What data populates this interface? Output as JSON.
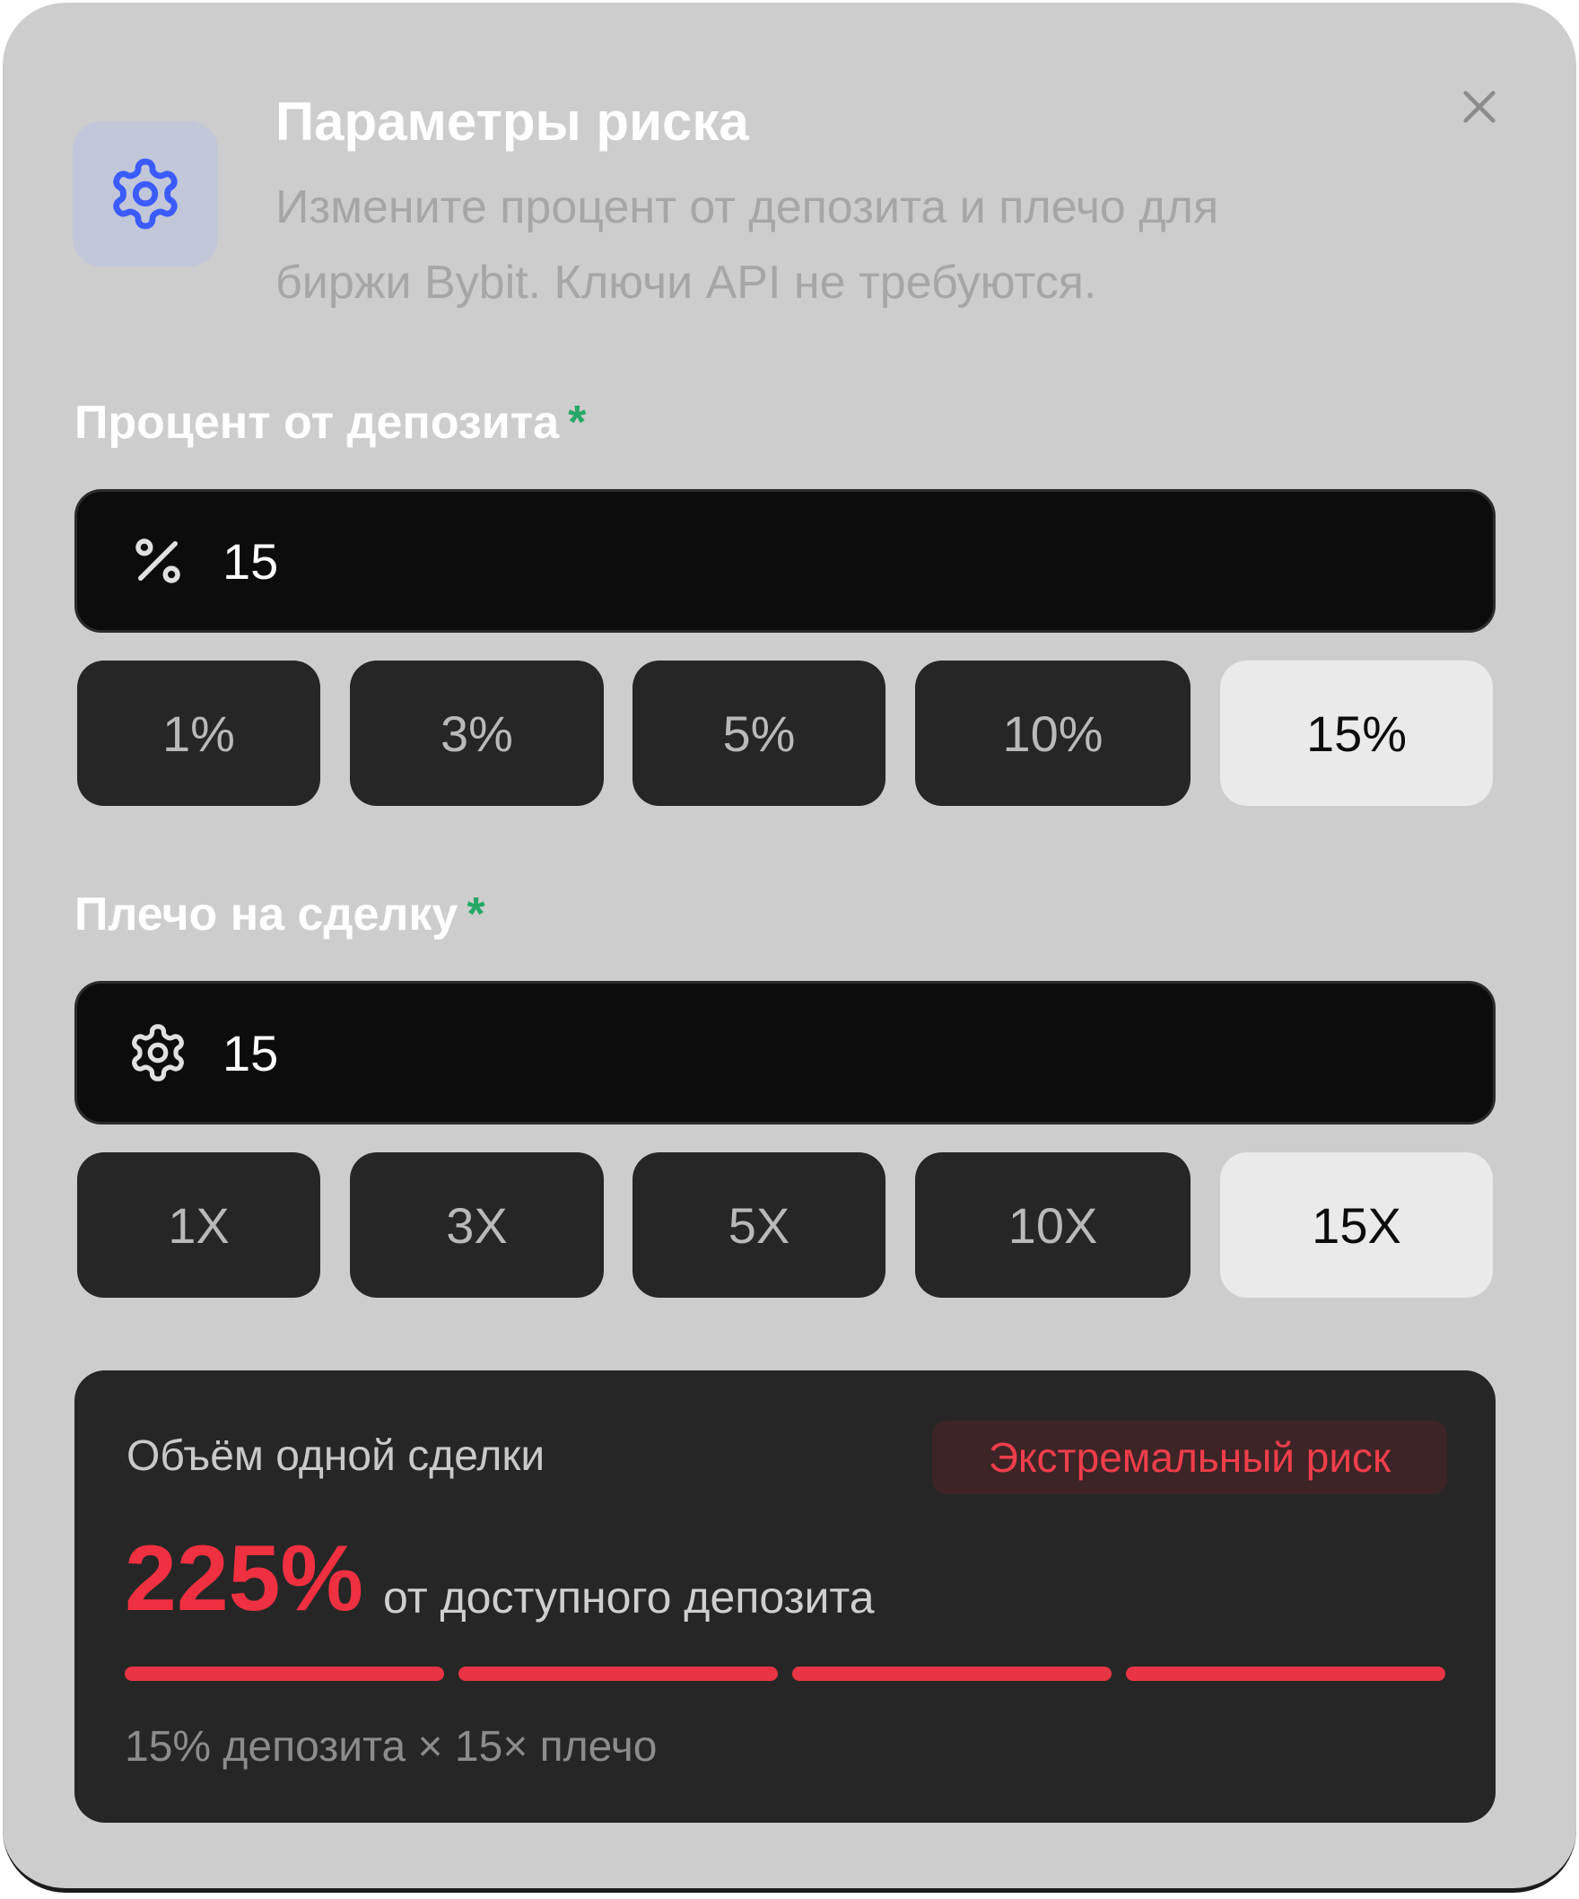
{
  "dialog": {
    "title": "Параметры риска",
    "subtitle_line1": "Измените процент от депозита и плечо для",
    "subtitle_line2": "биржи Bybit. Ключи API не требуются.",
    "header_icon": "gear-icon",
    "close_icon": "close-icon"
  },
  "deposit": {
    "label": "Процент от депозита",
    "required_mark": "*",
    "icon": "percent-icon",
    "value": "15",
    "presets": [
      "1%",
      "3%",
      "5%",
      "10%",
      "15%"
    ],
    "selected_preset": "15%"
  },
  "leverage": {
    "label": "Плечо на сделку",
    "required_mark": "*",
    "icon": "gear-icon",
    "value": "15",
    "presets": [
      "1X",
      "3X",
      "5X",
      "10X",
      "15X"
    ],
    "selected_preset": "15X"
  },
  "summary": {
    "label": "Объём одной сделки",
    "risk_badge": "Экстремальный риск",
    "value": "225%",
    "value_suffix": "от доступного депозита",
    "risk_segments_filled": 4,
    "risk_segments_total": 4,
    "formula": "15% депозита × 15× плечо"
  },
  "colors": {
    "accent_blue": "#3b5bfd",
    "required_green": "#25a866",
    "danger_red": "#ef3040",
    "modal_bg": "#cdcdcd",
    "input_bg": "#0c0c0c",
    "preset_bg": "#262626",
    "preset_active_bg": "#eaeaea"
  }
}
